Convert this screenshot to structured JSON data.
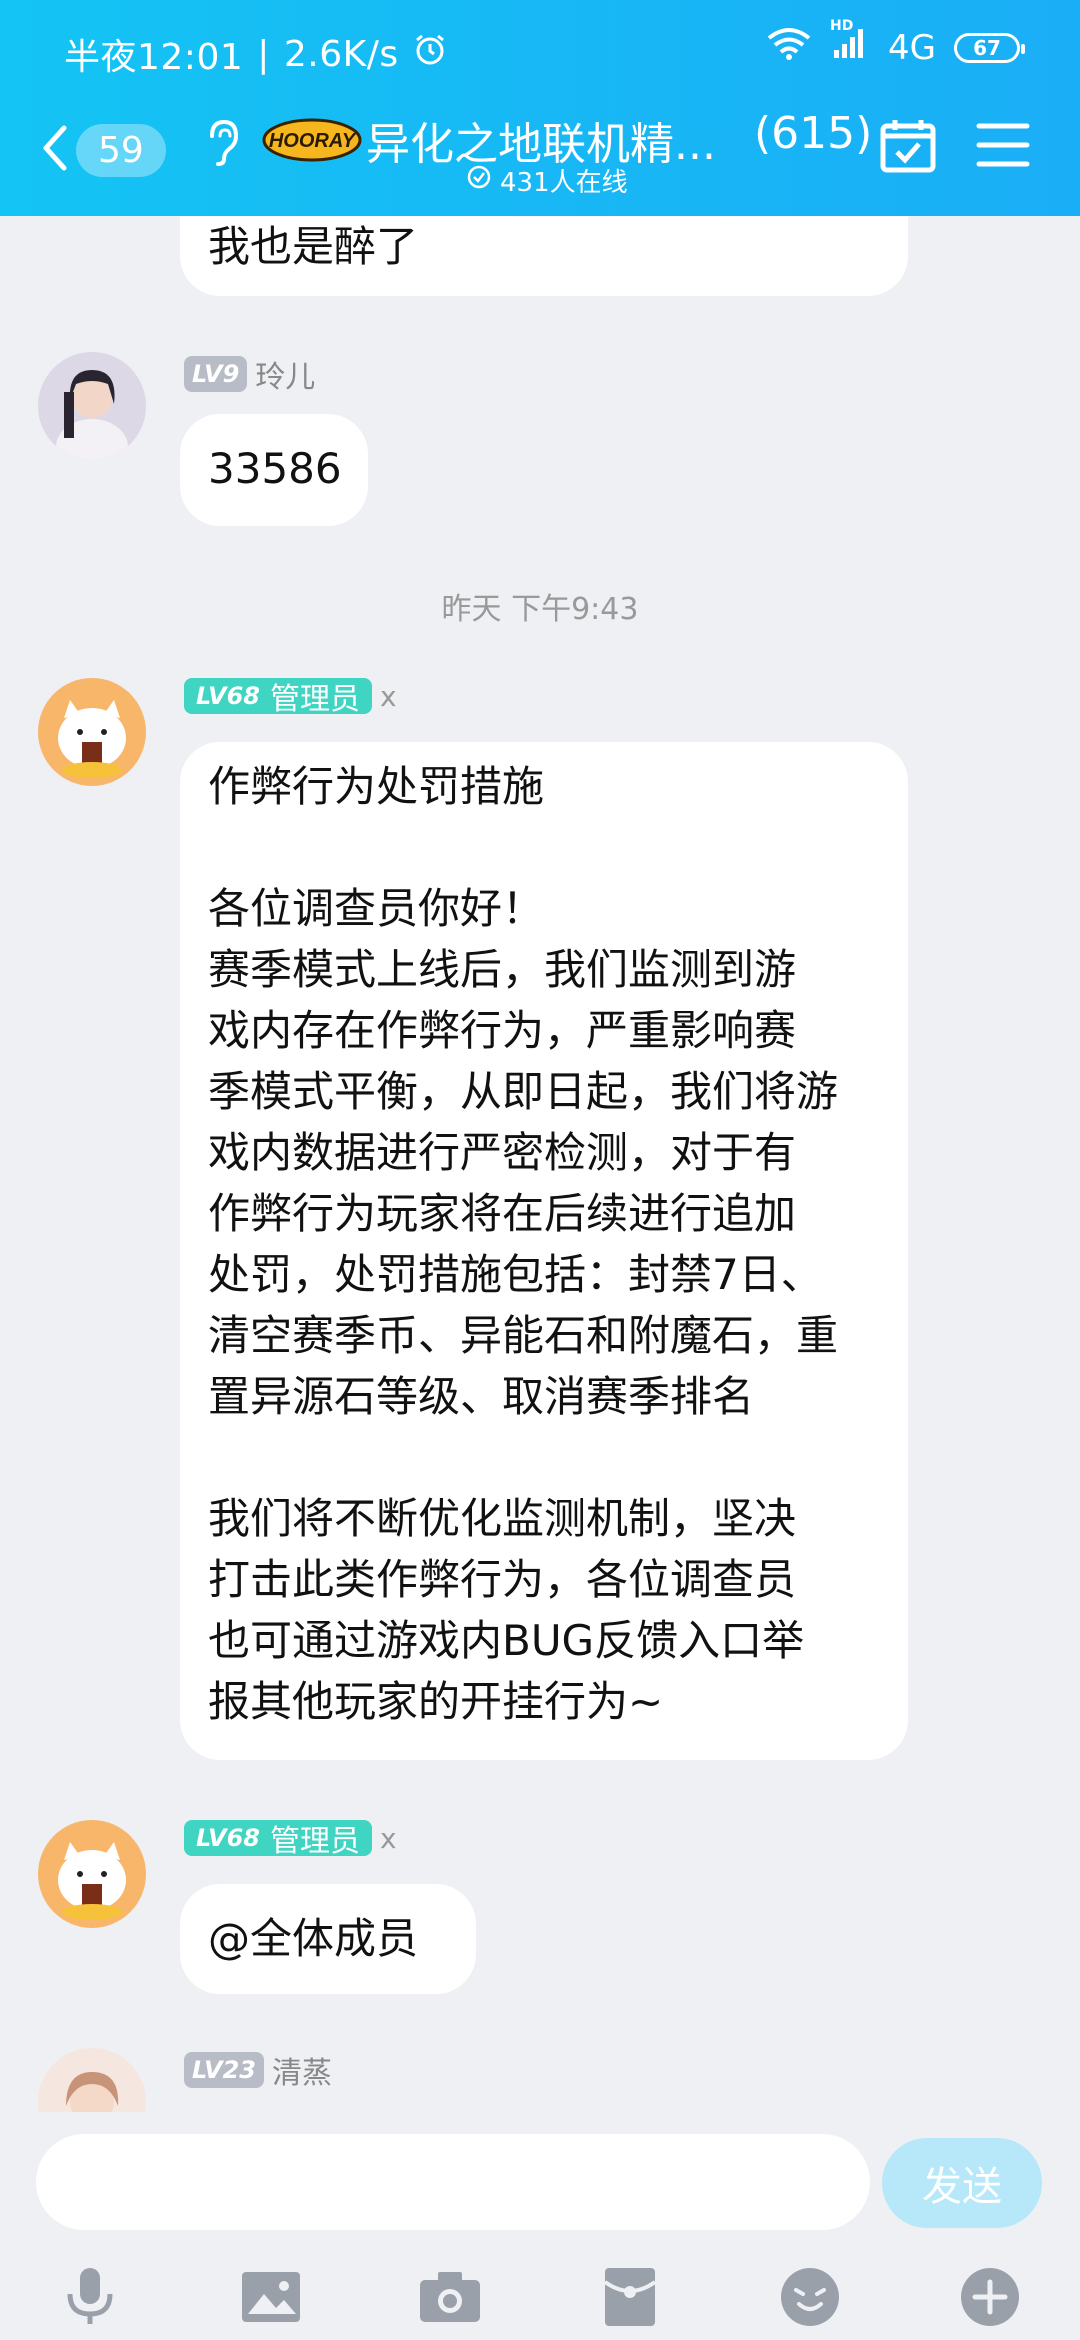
{
  "status_bar": {
    "time": "半夜12:01",
    "separator": "|",
    "speed": "2.6K/s",
    "network": "4G",
    "hd": "HD",
    "battery": "67"
  },
  "nav": {
    "unread_count": "59",
    "group_name": "异化之地联机精...",
    "member_count": "(615)",
    "online": "431人在线",
    "logo_text": "HOORAY"
  },
  "messages": {
    "m1_text": "我也是醉了",
    "m2_level": "LV9",
    "m2_sender": "玲儿",
    "m2_text": "33586",
    "timestamp": "昨天 下午9:43",
    "m3_level": "LV68",
    "m3_role": "管理员",
    "m3_x": "x",
    "m3_lines": [
      "作弊行为处罚措施",
      "",
      "各位调查员你好！",
      "赛季模式上线后，我们监测到游",
      "戏内存在作弊行为，严重影响赛",
      "季模式平衡，从即日起，我们将游",
      "戏内数据进行严密检测，对于有",
      "作弊行为玩家将在后续进行追加",
      "处罚，处罚措施包括：封禁7日、",
      "清空赛季币、异能石和附魔石，重",
      "置异源石等级、取消赛季排名",
      "",
      "我们将不断优化监测机制，坚决",
      "打击此类作弊行为，各位调查员",
      "也可通过游戏内BUG反馈入口举",
      "报其他玩家的开挂行为~"
    ],
    "m4_level": "LV68",
    "m4_role": "管理员",
    "m4_x": "x",
    "m4_text": "@全体成员",
    "m5_level": "LV23",
    "m5_sender": "清蒸"
  },
  "input": {
    "placeholder": "",
    "send_label": "发送"
  },
  "toolbar": {
    "icons": [
      "microphone-icon",
      "image-icon",
      "camera-icon",
      "red-packet-icon",
      "emoji-icon",
      "plus-icon"
    ]
  },
  "colors": {
    "header_start": "#14c4f4",
    "header_end": "#1aaef6",
    "chat_bg": "#eef0f4",
    "admin_badge": "#40d4c2",
    "level_badge": "#b8bcc6",
    "send_button": "#b6e8f9"
  }
}
